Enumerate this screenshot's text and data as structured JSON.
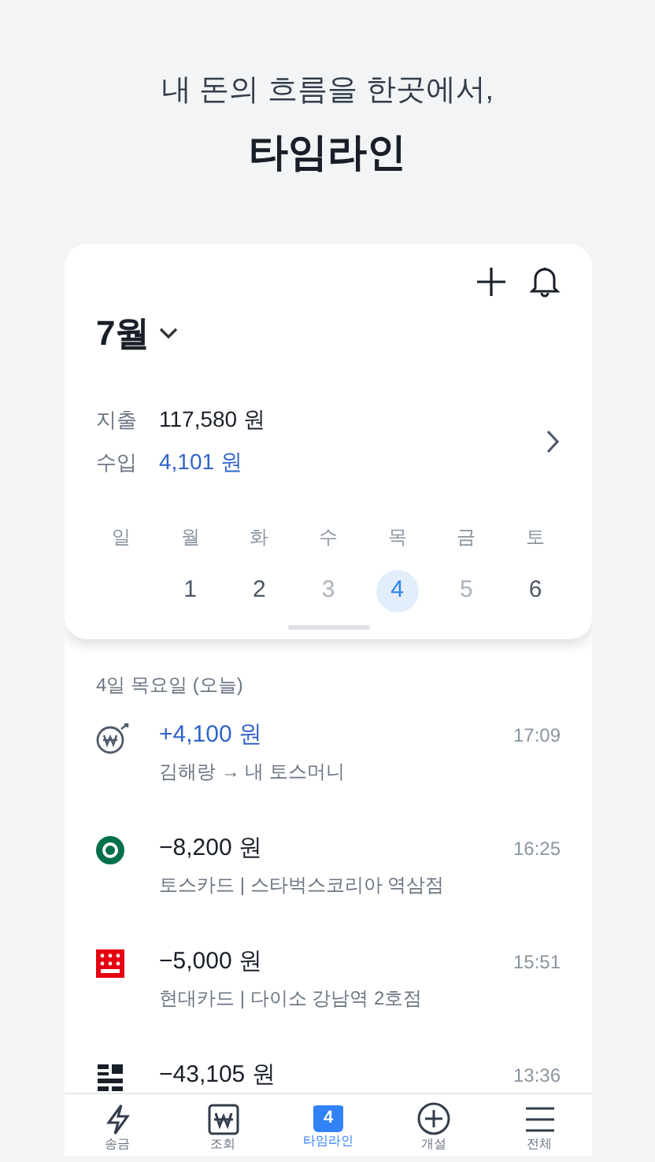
{
  "headline": {
    "subtitle": "내 돈의 흐름을 한곳에서,",
    "title": "타임라인"
  },
  "header": {
    "month": "7월"
  },
  "summary": [
    {
      "label": "지출",
      "amount": "117,580 원",
      "kind": "expense"
    },
    {
      "label": "수입",
      "amount": "4,101 원",
      "kind": "income"
    }
  ],
  "week": [
    {
      "day": "일"
    },
    {
      "day": "월",
      "date": "1",
      "selected": false,
      "disabled": false
    },
    {
      "day": "화",
      "date": "2",
      "selected": false,
      "disabled": false
    },
    {
      "day": "수",
      "date": "3",
      "selected": false,
      "disabled": true
    },
    {
      "day": "목",
      "date": "4",
      "selected": true,
      "disabled": false
    },
    {
      "day": "금",
      "date": "5",
      "selected": false,
      "disabled": true
    },
    {
      "day": "토",
      "date": "6",
      "selected": false,
      "disabled": false
    }
  ],
  "day_heading": "4일 목요일 (오늘)",
  "transactions": [
    {
      "kind": "transfer",
      "amount": "+4,100 원",
      "income": true,
      "detail": "김해랑 → 내 토스머니",
      "time": "17:09"
    },
    {
      "kind": "cafe",
      "amount": "−8,200 원",
      "income": false,
      "detail": "토스카드 | 스타벅스코리아 역삼점",
      "time": "16:25"
    },
    {
      "kind": "store",
      "amount": "−5,000 원",
      "income": false,
      "detail": "현대카드 | 다이소 강남역 2호점",
      "time": "15:51"
    },
    {
      "kind": "delivery",
      "amount": "−43,105 원",
      "income": false,
      "time": "13:36"
    }
  ],
  "tab_bar": [
    {
      "label": "송금",
      "selected": false
    },
    {
      "label": "조회",
      "selected": false
    },
    {
      "badge": "4",
      "label": "타임라인",
      "selected": true
    },
    {
      "label": "개설",
      "selected": false
    },
    {
      "label": "전체",
      "selected": false
    }
  ]
}
